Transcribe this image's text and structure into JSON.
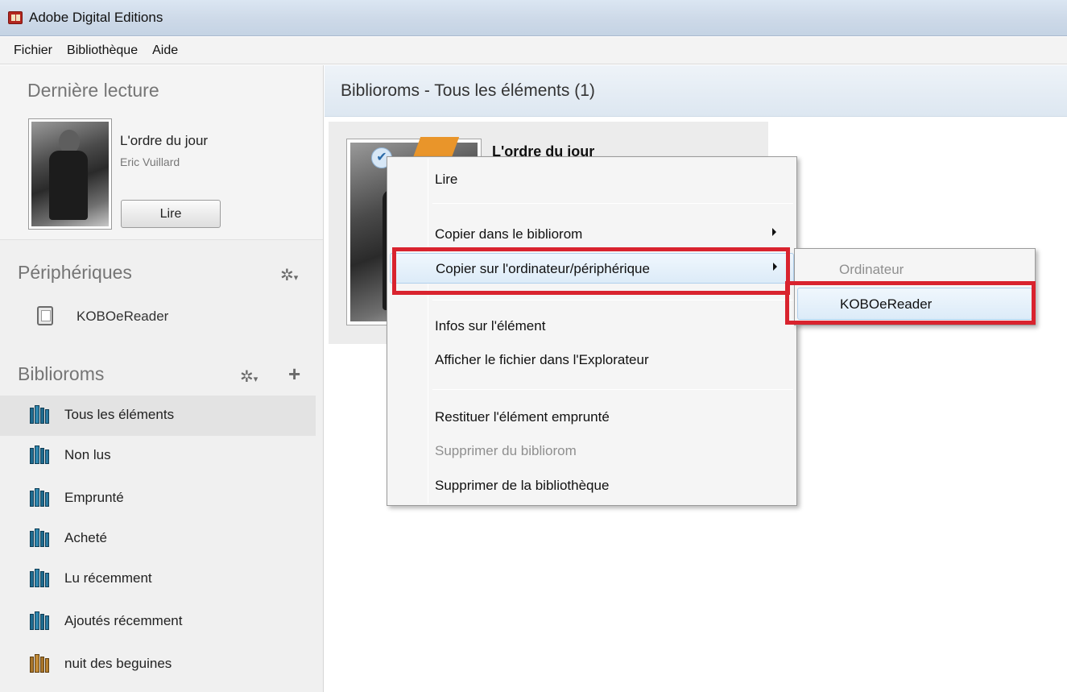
{
  "window": {
    "title": "Adobe Digital Editions"
  },
  "menubar": {
    "items": [
      "Fichier",
      "Bibliothèque",
      "Aide"
    ]
  },
  "sidebar": {
    "last_read": {
      "heading": "Dernière lecture",
      "book_title": "L'ordre du jour",
      "book_author": "Eric Vuillard",
      "read_button": "Lire"
    },
    "devices": {
      "heading": "Périphériques",
      "gear_glyph": "✲",
      "items": [
        {
          "label": "KOBOeReader",
          "icon": "tablet-icon"
        }
      ]
    },
    "bookshelves": {
      "heading": "Biblioroms",
      "gear_glyph": "✲",
      "add_glyph": "+",
      "items": [
        {
          "label": "Tous les éléments",
          "selected": true,
          "icon": "bookshelf-icon"
        },
        {
          "label": "Non lus",
          "icon": "bookshelf-icon"
        },
        {
          "label": "Emprunté",
          "icon": "bookshelf-icon"
        },
        {
          "label": "Acheté",
          "icon": "bookshelf-icon"
        },
        {
          "label": "Lu récemment",
          "icon": "bookshelf-icon"
        },
        {
          "label": "Ajoutés récemment",
          "icon": "bookshelf-icon"
        },
        {
          "label": "nuit des beguines",
          "icon": "bookshelf-brown-icon"
        }
      ]
    }
  },
  "main": {
    "title": "Biblioroms - Tous les éléments (1)",
    "book_card": {
      "title": "L'ordre du jour",
      "check_glyph": "✔"
    }
  },
  "context_menu": {
    "items": {
      "read": "Lire",
      "copy_to_shelf": "Copier dans le bibliorom",
      "copy_to_device": "Copier sur l'ordinateur/périphérique",
      "item_info": "Infos sur l'élément",
      "show_in_explorer": "Afficher le fichier dans l'Explorateur",
      "return_borrowed": "Restituer l'élément emprunté",
      "remove_from_shelf": "Supprimer du bibliorom",
      "remove_from_library": "Supprimer de la bibliothèque"
    },
    "highlight_color": "#d9232e"
  },
  "submenu": {
    "items": {
      "computer": "Ordinateur",
      "device": "KOBOeReader"
    }
  }
}
